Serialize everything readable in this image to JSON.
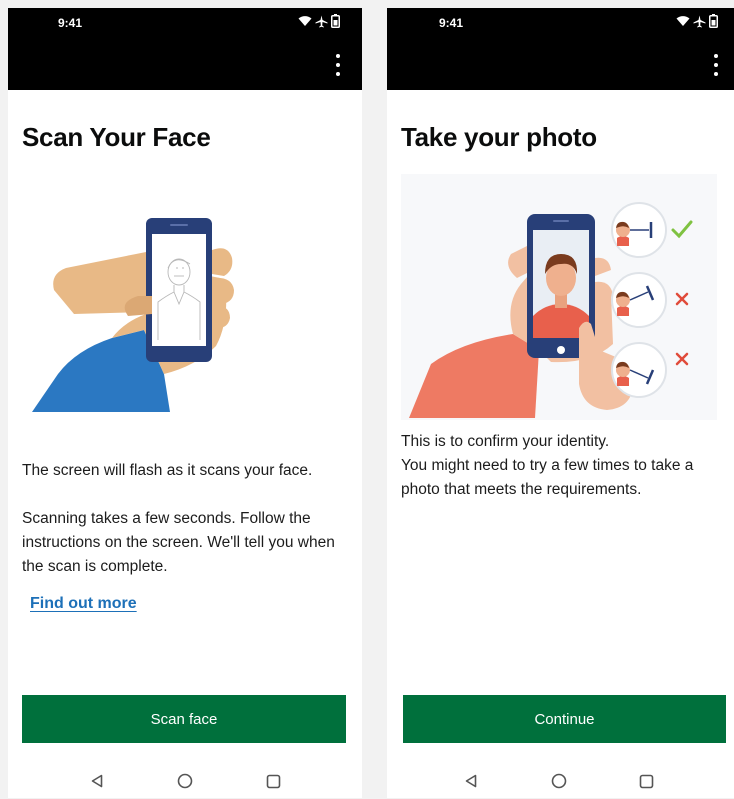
{
  "left": {
    "status_time": "9:41",
    "title": "Scan Your Face",
    "paragraph1": "The screen will flash as it scans your face.",
    "paragraph2": "Scanning takes a few seconds. Follow the instructions on the screen. We'll tell you when the scan is complete.",
    "link_label": "Find out more",
    "button_label": "Scan face"
  },
  "right": {
    "status_time": "9:41",
    "title": "Take your photo",
    "paragraph1": "This is to confirm your identity.",
    "paragraph2": "You might need to try a few times to take a photo that meets the requirements.",
    "button_label": "Continue"
  },
  "icons": {
    "status": [
      "wifi-icon",
      "airplane-icon",
      "battery-icon"
    ],
    "menu": "more-vertical-icon",
    "nav": [
      "back-triangle-icon",
      "home-circle-icon",
      "recents-square-icon"
    ],
    "check": "check-icon",
    "cross": "cross-icon"
  },
  "colors": {
    "button_green": "#00703c",
    "link_blue": "#1d70b8",
    "sleeve_blue": "#2b78c2",
    "sleeve_coral": "#ee7a63",
    "phone_navy": "#283f78",
    "check_green": "#7fc241",
    "cross_red": "#e04b3a"
  }
}
